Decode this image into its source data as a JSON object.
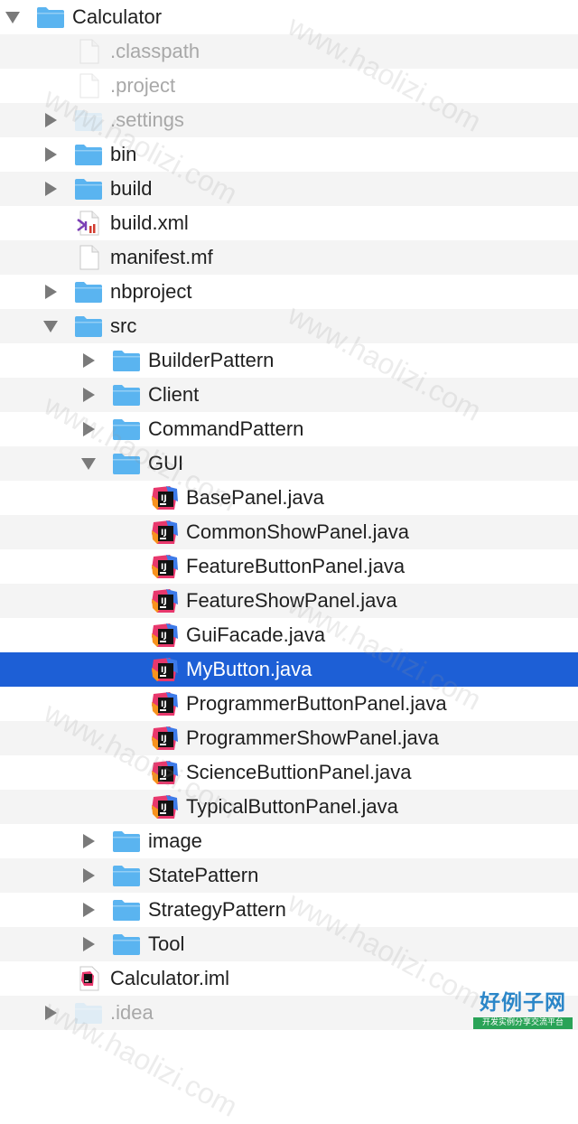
{
  "colors": {
    "folder": "#5bb4f0",
    "folder_dim": "#c7e4f8",
    "selection": "#1d5fd6",
    "alt_row": "#f4f4f4",
    "disclosure": "#7a7a7a"
  },
  "tree": [
    {
      "label": "Calculator",
      "depth": 0,
      "type": "folder",
      "disclosure": "down",
      "dim": false
    },
    {
      "label": ".classpath",
      "depth": 1,
      "type": "file",
      "disclosure": "none",
      "dim": true
    },
    {
      "label": ".project",
      "depth": 1,
      "type": "file",
      "disclosure": "none",
      "dim": true
    },
    {
      "label": ".settings",
      "depth": 1,
      "type": "folder",
      "disclosure": "right",
      "dim": true
    },
    {
      "label": "bin",
      "depth": 1,
      "type": "folder",
      "disclosure": "right",
      "dim": false
    },
    {
      "label": "build",
      "depth": 1,
      "type": "folder",
      "disclosure": "right",
      "dim": false
    },
    {
      "label": "build.xml",
      "depth": 1,
      "type": "xml",
      "disclosure": "none",
      "dim": false
    },
    {
      "label": "manifest.mf",
      "depth": 1,
      "type": "file",
      "disclosure": "none",
      "dim": false
    },
    {
      "label": "nbproject",
      "depth": 1,
      "type": "folder",
      "disclosure": "right",
      "dim": false
    },
    {
      "label": "src",
      "depth": 1,
      "type": "folder",
      "disclosure": "down",
      "dim": false
    },
    {
      "label": "BuilderPattern",
      "depth": 2,
      "type": "folder",
      "disclosure": "right",
      "dim": false
    },
    {
      "label": "Client",
      "depth": 2,
      "type": "folder",
      "disclosure": "right",
      "dim": false
    },
    {
      "label": "CommandPattern",
      "depth": 2,
      "type": "folder",
      "disclosure": "right",
      "dim": false
    },
    {
      "label": "GUI",
      "depth": 2,
      "type": "folder",
      "disclosure": "down",
      "dim": false
    },
    {
      "label": "BasePanel.java",
      "depth": 3,
      "type": "java",
      "disclosure": "none",
      "dim": false
    },
    {
      "label": "CommonShowPanel.java",
      "depth": 3,
      "type": "java",
      "disclosure": "none",
      "dim": false
    },
    {
      "label": "FeatureButtonPanel.java",
      "depth": 3,
      "type": "java",
      "disclosure": "none",
      "dim": false
    },
    {
      "label": "FeatureShowPanel.java",
      "depth": 3,
      "type": "java",
      "disclosure": "none",
      "dim": false
    },
    {
      "label": "GuiFacade.java",
      "depth": 3,
      "type": "java",
      "disclosure": "none",
      "dim": false
    },
    {
      "label": "MyButton.java",
      "depth": 3,
      "type": "java",
      "disclosure": "none",
      "dim": false,
      "selected": true
    },
    {
      "label": "ProgrammerButtonPanel.java",
      "depth": 3,
      "type": "java",
      "disclosure": "none",
      "dim": false
    },
    {
      "label": "ProgrammerShowPanel.java",
      "depth": 3,
      "type": "java",
      "disclosure": "none",
      "dim": false
    },
    {
      "label": "ScienceButtionPanel.java",
      "depth": 3,
      "type": "java",
      "disclosure": "none",
      "dim": false
    },
    {
      "label": "TypicalButtonPanel.java",
      "depth": 3,
      "type": "java",
      "disclosure": "none",
      "dim": false
    },
    {
      "label": "image",
      "depth": 2,
      "type": "folder",
      "disclosure": "right",
      "dim": false
    },
    {
      "label": "StatePattern",
      "depth": 2,
      "type": "folder",
      "disclosure": "right",
      "dim": false
    },
    {
      "label": "StrategyPattern",
      "depth": 2,
      "type": "folder",
      "disclosure": "right",
      "dim": false
    },
    {
      "label": "Tool",
      "depth": 2,
      "type": "folder",
      "disclosure": "right",
      "dim": false
    },
    {
      "label": "Calculator.iml",
      "depth": 1,
      "type": "iml",
      "disclosure": "none",
      "dim": false
    },
    {
      "label": ".idea",
      "depth": 1,
      "type": "folder",
      "disclosure": "right",
      "dim": true
    }
  ],
  "watermark": {
    "logo_text": "好例子网",
    "logo_subtext": "开发实例分享交流平台",
    "overlay_text": "www.haolizi.com"
  }
}
